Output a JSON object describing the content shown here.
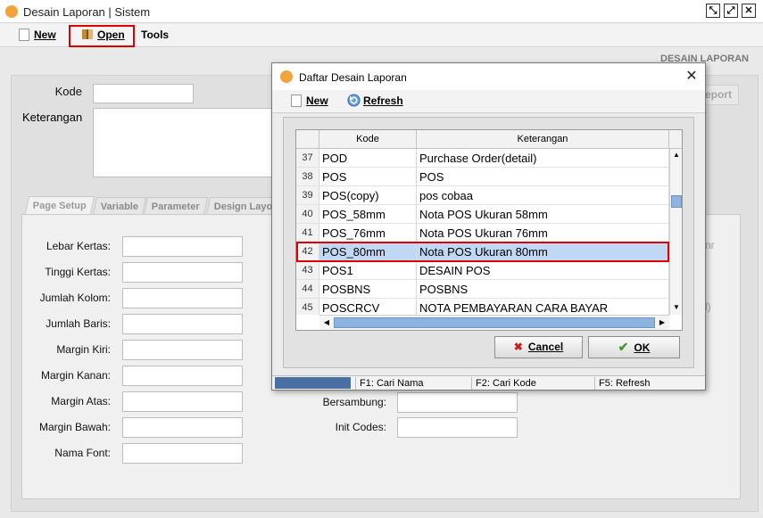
{
  "window": {
    "title": "Desain Laporan | Sistem"
  },
  "toolbar": {
    "new_label": "New",
    "open_label": "Open",
    "tools_label": "Tools"
  },
  "header_label": "DESAIN LAPORAN",
  "form": {
    "kode_label": "Kode",
    "keterangan_label": "Keterangan",
    "report_button": "eport",
    "tabs": [
      "Page Setup",
      "Variable",
      "Parameter",
      "Design Layo"
    ],
    "fields_left": [
      "Lebar Kertas:",
      "Tinggi Kertas:",
      "Jumlah Kolom:",
      "Jumlah Baris:",
      "Margin Kiri:",
      "Margin Kanan:",
      "Margin Atas:",
      "Margin Bawah:",
      "Nama Font:"
    ],
    "fields_right": [
      "Bersambung:",
      "Init Codes:"
    ],
    "side_fragments": [
      "nr",
      "l)"
    ]
  },
  "dialog": {
    "title": "Daftar Desain Laporan",
    "new_label": "New",
    "refresh_label": "Refresh",
    "columns": [
      "Kode",
      "Keterangan"
    ],
    "rows": [
      {
        "num": "37",
        "kode": "POD",
        "ket": "Purchase Order(detail)"
      },
      {
        "num": "38",
        "kode": "POS",
        "ket": "POS"
      },
      {
        "num": "39",
        "kode": "POS(copy)",
        "ket": "pos cobaa"
      },
      {
        "num": "40",
        "kode": "POS_58mm",
        "ket": "Nota POS Ukuran 58mm"
      },
      {
        "num": "41",
        "kode": "POS_76mm",
        "ket": "Nota POS Ukuran 76mm"
      },
      {
        "num": "42",
        "kode": "POS_80mm",
        "ket": "Nota POS Ukuran 80mm"
      },
      {
        "num": "43",
        "kode": "POS1",
        "ket": "DESAIN POS"
      },
      {
        "num": "44",
        "kode": "POSBNS",
        "ket": "POSBNS"
      },
      {
        "num": "45",
        "kode": "POSCRCV",
        "ket": "NOTA PEMBAYARAN CARA BAYAR"
      }
    ],
    "selected_row": "42",
    "cancel_label": "Cancel",
    "ok_label": "OK",
    "status": [
      "",
      "F1: Cari Nama",
      "F2: Cari Kode",
      "F5: Refresh"
    ]
  },
  "colors": {
    "highlight": "#e00000",
    "selection": "#bfd9f4",
    "icon_accent": "#f2a33a"
  }
}
